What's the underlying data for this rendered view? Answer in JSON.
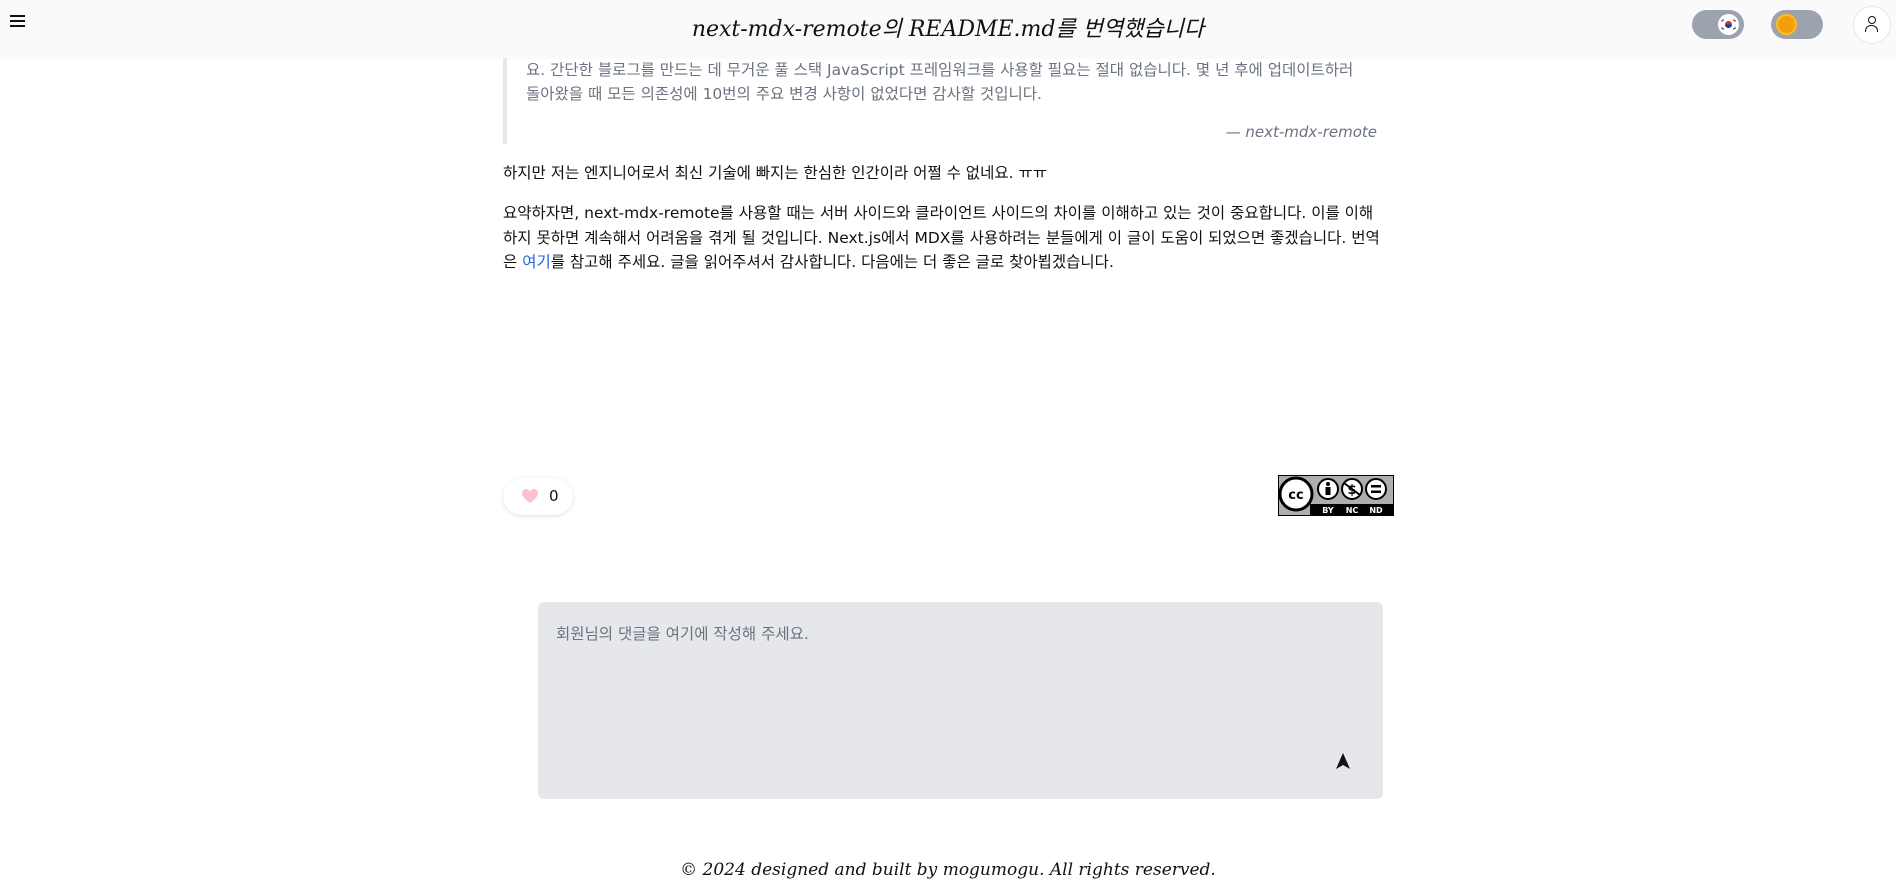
{
  "header": {
    "title": "next-mdx-remote의 README.md를 번역했습니다",
    "menu_icon": "hamburger-menu-icon",
    "language_toggle_icon": "korea-flag-icon",
    "theme_toggle_icon": "sun-icon",
    "profile_icon": "user-icon"
  },
  "article": {
    "quote_text": "요. 간단한 블로그를 만드는 데 무거운 풀 스택 JavaScript 프레임워크를 사용할 필요는 절대 없습니다. 몇 년 후에 업데이트하러 돌아왔을 때 모든 의존성에 10번의 주요 변경 사항이 없었다면 감사할 것입니다.",
    "quote_cite": "— next-mdx-remote",
    "paragraph1": "하지만 저는 엔지니어로서 최신 기술에 빠지는 한심한 인간이라 어쩔 수 없네요. ㅠㅠ",
    "paragraph2_before": "요약하자면, next-mdx-remote를 사용할 때는 서버 사이드와 클라이언트 사이드의 차이를 이해하고 있는 것이 중요합니다. 이를 이해하지 못하면 계속해서 어려움을 겪게 될 것입니다. Next.js에서 MDX를 사용하려는 분들에게 이 글이 도움이 되었으면 좋겠습니다. 번역은 ",
    "paragraph2_link": "여기",
    "paragraph2_after": "를 참고해 주세요. 글을 읽어주셔서 감사합니다. 다음에는 더 좋은 글로 찾아뵙겠습니다."
  },
  "reactions": {
    "like_icon": "heart-icon",
    "like_count": "0",
    "heart_color": "#f9c3cc"
  },
  "license": {
    "icon": "cc-by-nc-nd-icon",
    "cc": "cc",
    "labels": [
      "BY",
      "NC",
      "ND"
    ]
  },
  "comments": {
    "placeholder": "회원님의 댓글을 여기에 작성해 주세요.",
    "send_icon": "send-icon"
  },
  "footer": {
    "text": "© 2024 designed and built by mogumogu. All rights reserved."
  },
  "colors": {
    "link": "#2563eb",
    "comment_bg": "#e5e7eb",
    "toggle_bg": "#9ca3af",
    "sun": "#f59e0b"
  }
}
